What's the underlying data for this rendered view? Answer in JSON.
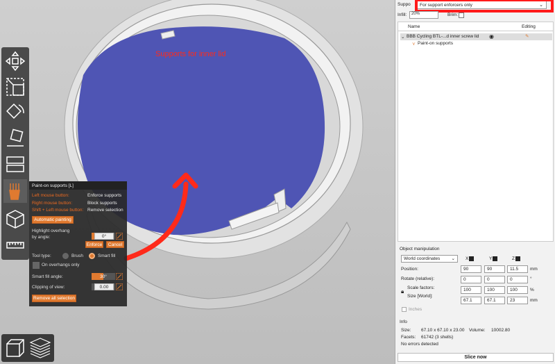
{
  "viewport": {
    "overlay_label": "Supports for inner lid"
  },
  "toolbar": {
    "tools": [
      "move-icon",
      "scale-icon",
      "rotate-icon",
      "place-on-face-icon",
      "cut-icon",
      "paint-supports-icon",
      "seam-icon",
      "measure-icon"
    ]
  },
  "paint_panel": {
    "title": "Paint-on supports [L]",
    "rows": [
      {
        "key": "Left mouse button:",
        "value": "Enforce supports"
      },
      {
        "key": "Right mouse button:",
        "value": "Block supports"
      },
      {
        "key": "Shift + Left mouse button:",
        "value": "Remove selection"
      }
    ],
    "auto_painting": "Automatic painting",
    "highlight_label_1": "Highlight overhang",
    "highlight_label_2": "by angle:",
    "overhang_angle": "0°",
    "enforce": "Enforce",
    "cancel": "Cancel",
    "tool_type": "Tool type:",
    "brush": "Brush",
    "smart_fill": "Smart fill",
    "on_overhangs_only": "On overhangs only",
    "smart_fill_angle_label": "Smart fill angle:",
    "smart_fill_angle": "30°",
    "smart_fill_fraction": 0.5,
    "clipping_label": "Clipping of view:",
    "clipping_value": "0.00",
    "remove_all": "Remove all selection"
  },
  "sidebar": {
    "supports_label": "Suppo",
    "supports_value": "For support enforcers only",
    "infill_label": "Infill:",
    "infill_value": "20%",
    "brim_label": "Brim:",
    "list_headers": {
      "name": "Name",
      "editing": "Editing"
    },
    "objects": [
      {
        "name": "BBB Cycling BTL-...d inner screw lid"
      },
      {
        "name": "Paint-on supports"
      }
    ],
    "object_manipulation": {
      "title": "Object manipulation",
      "coord_system": "World coordinates",
      "axes": [
        "X",
        "Y",
        "Z"
      ],
      "position_label": "Position:",
      "position": [
        "90",
        "90",
        "11.5"
      ],
      "position_unit": "mm",
      "rotate_label": "Rotate (relative):",
      "rotate": [
        "0",
        "0",
        "0"
      ],
      "rotate_unit": "°",
      "scale_label": "Scale factors:",
      "scale": [
        "100",
        "100",
        "100"
      ],
      "scale_unit": "%",
      "size_label": "Size [World]:",
      "size": [
        "67.1",
        "67.1",
        "23"
      ],
      "size_unit": "mm",
      "inches_label": "Inches"
    },
    "info": {
      "title": "Info",
      "size_label": "Size:",
      "size_value": "67.10 x 67.10 x 23.00",
      "volume_label": "Volume:",
      "volume_value": "10002.80",
      "facets_label": "Facets:",
      "facets_value": "61742 (3 shells)",
      "errors": "No errors detected"
    },
    "slice_now": "Slice now"
  },
  "colors": {
    "accent": "#e07a30",
    "paint_blue": "#4f55b4",
    "annotation_red": "#ff2a1a"
  }
}
